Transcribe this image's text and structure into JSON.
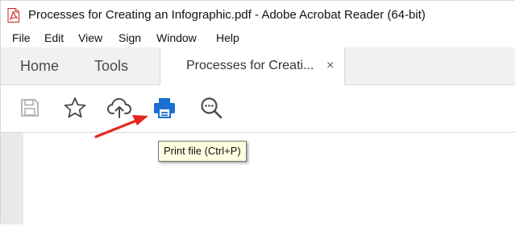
{
  "window": {
    "title": "Processes for Creating an Infographic.pdf - Adobe Acrobat Reader (64-bit)",
    "app_icon": "acrobat-pdf-icon"
  },
  "menu": {
    "items": [
      "File",
      "Edit",
      "View",
      "Sign",
      "Window",
      "Help"
    ]
  },
  "tabs": {
    "home": "Home",
    "tools": "Tools",
    "document": "Processes for Creati...",
    "close_glyph": "×"
  },
  "toolbar": {
    "buttons": [
      "save-icon",
      "bookmark-star-icon",
      "cloud-upload-icon",
      "print-icon",
      "zoom-search-icon"
    ]
  },
  "tooltip": {
    "text": "Print file (Ctrl+P)"
  },
  "colors": {
    "accent_blue": "#1b6fd0",
    "annotation_red": "#e8261e",
    "tooltip_bg": "#ffffe1"
  }
}
